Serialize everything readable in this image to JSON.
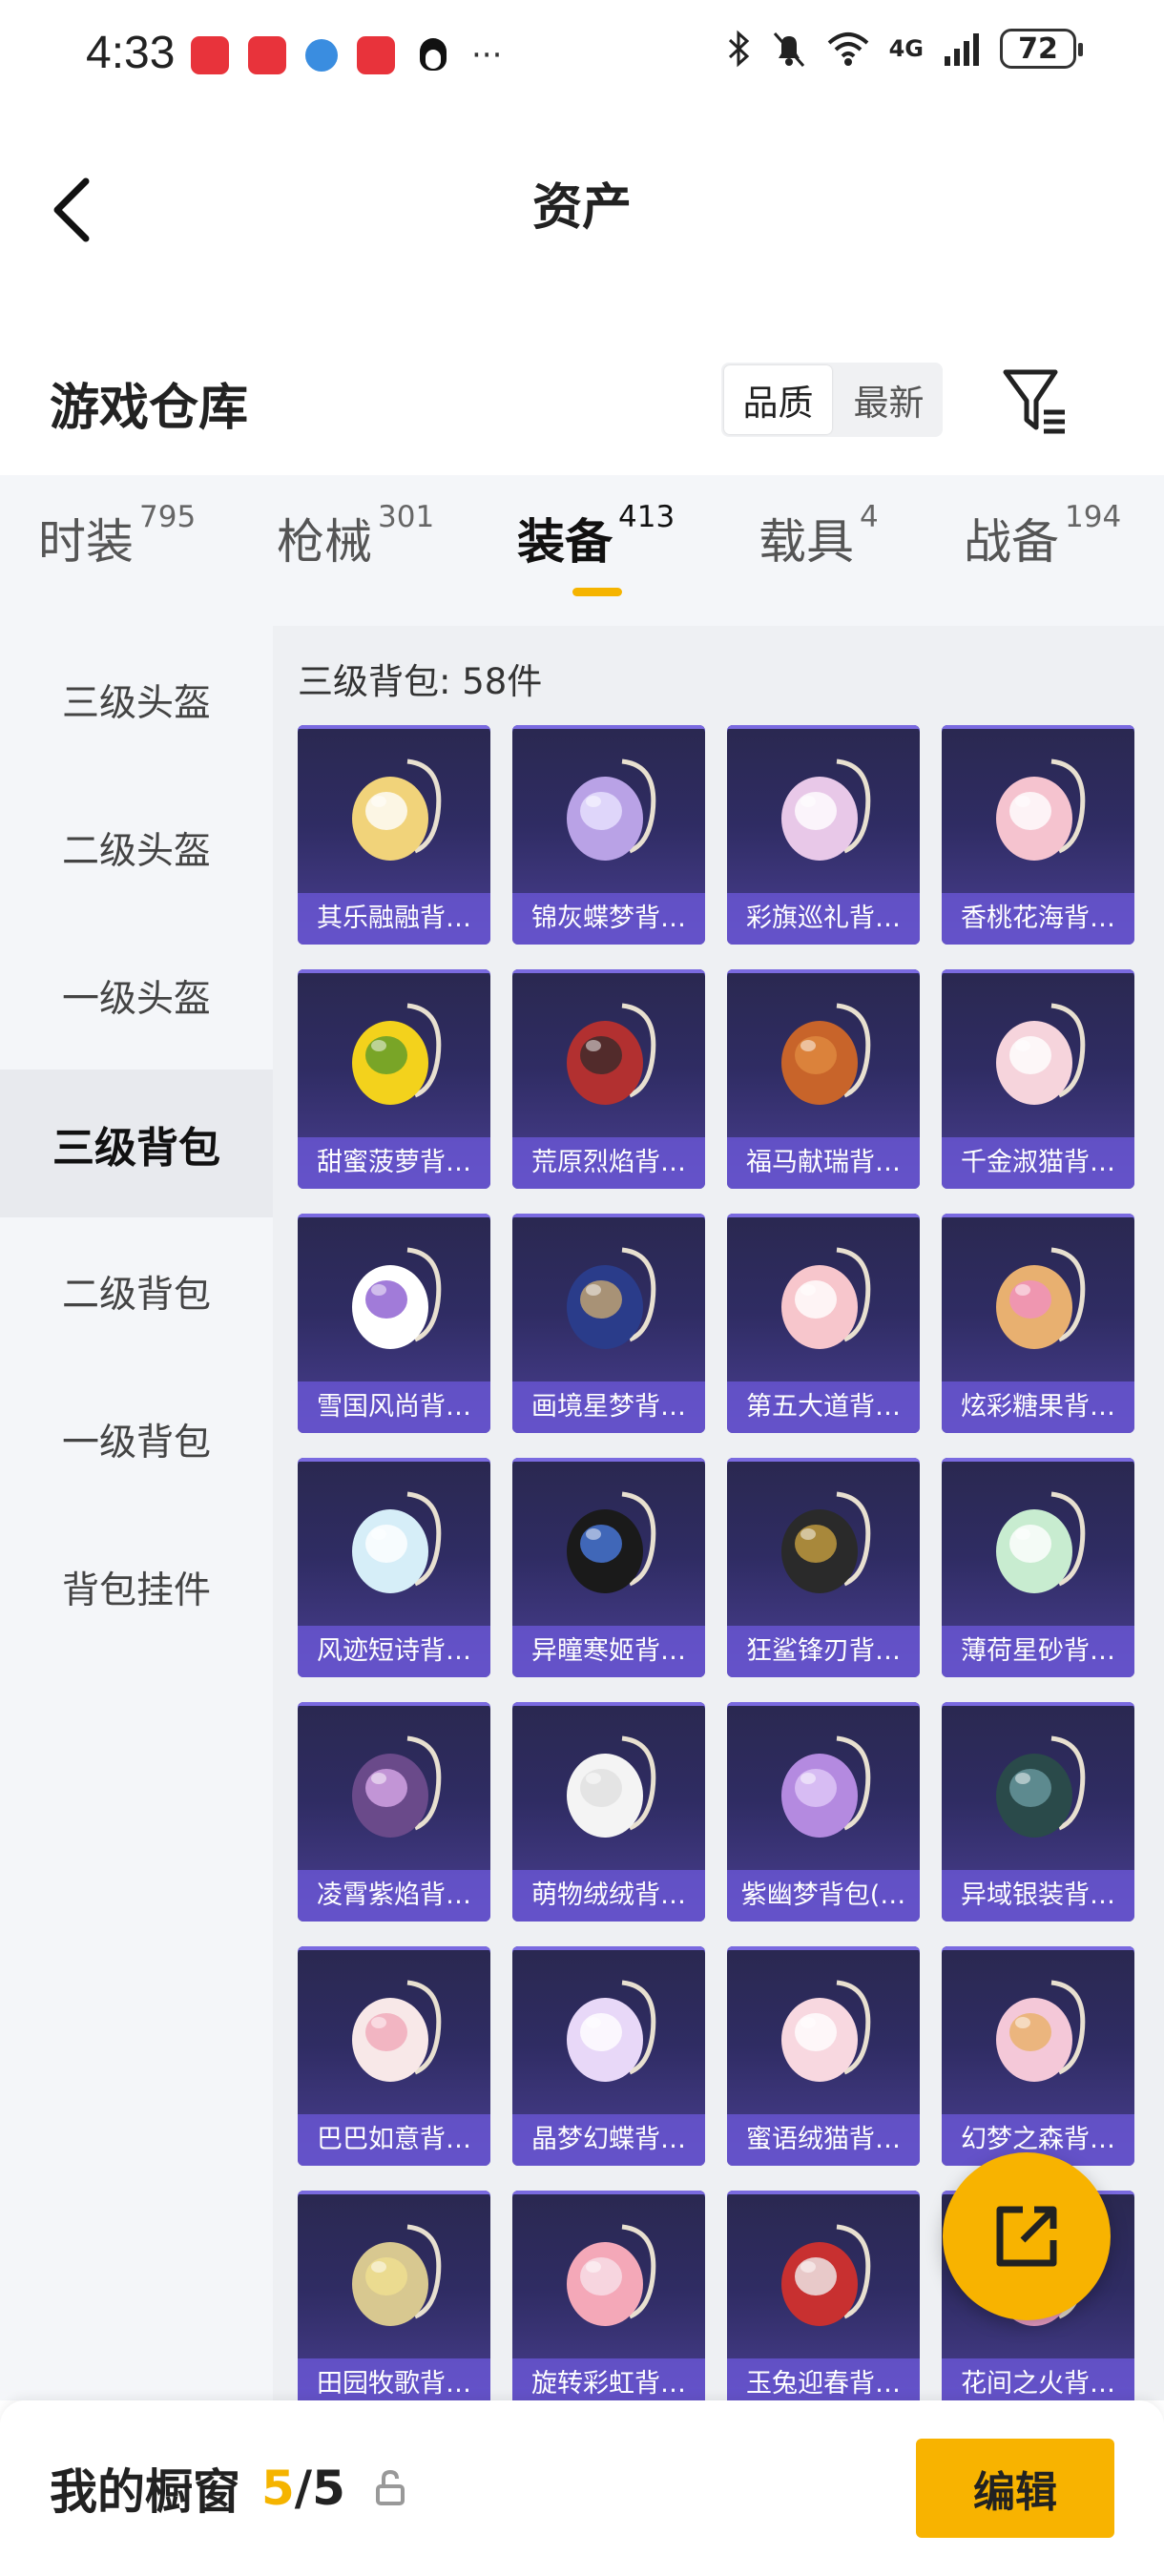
{
  "status_bar": {
    "time": "4:33",
    "network": "4G",
    "battery": "72"
  },
  "header": {
    "title": "资产"
  },
  "warehouse": {
    "title": "游戏仓库",
    "sort_options": [
      "品质",
      "最新"
    ],
    "sort_selected": "品质"
  },
  "tabs": [
    {
      "label": "时装",
      "count": "795"
    },
    {
      "label": "枪械",
      "count": "301"
    },
    {
      "label": "装备",
      "count": "413"
    },
    {
      "label": "载具",
      "count": "4"
    },
    {
      "label": "战备",
      "count": "194"
    }
  ],
  "active_tab": "装备",
  "sidebar": {
    "items": [
      "三级头盔",
      "二级头盔",
      "一级头盔",
      "三级背包",
      "二级背包",
      "一级背包",
      "背包挂件"
    ],
    "active": "三级背包"
  },
  "content": {
    "count_label": "三级背包: 58件",
    "items": [
      "其乐融融背…",
      "锦灰蝶梦背…",
      "彩旗巡礼背…",
      "香桃花海背…",
      "甜蜜菠萝背…",
      "荒原烈焰背…",
      "福马献瑞背…",
      "千金淑猫背…",
      "雪国风尚背…",
      "画境星梦背…",
      "第五大道背…",
      "炫彩糖果背…",
      "风迹短诗背…",
      "异瞳寒姬背…",
      "狂鲨锋刃背…",
      "薄荷星砂背…",
      "凌霄紫焰背…",
      "萌物绒绒背…",
      "紫幽梦背包(…",
      "异域银装背…",
      "巴巴如意背…",
      "晶梦幻蝶背…",
      "蜜语绒猫背…",
      "幻梦之森背…",
      "田园牧歌背…",
      "旋转彩虹背…",
      "玉兔迎春背…",
      "花间之火背…"
    ]
  },
  "bottom_bar": {
    "label": "我的橱窗",
    "used": "5",
    "separator": "/",
    "total": "5",
    "edit_label": "编辑"
  },
  "colors": {
    "accent": "#f8b300",
    "card_top": "#2a2850",
    "card_bottom": "#4a3f92",
    "name_bar": "#6e5adc"
  }
}
